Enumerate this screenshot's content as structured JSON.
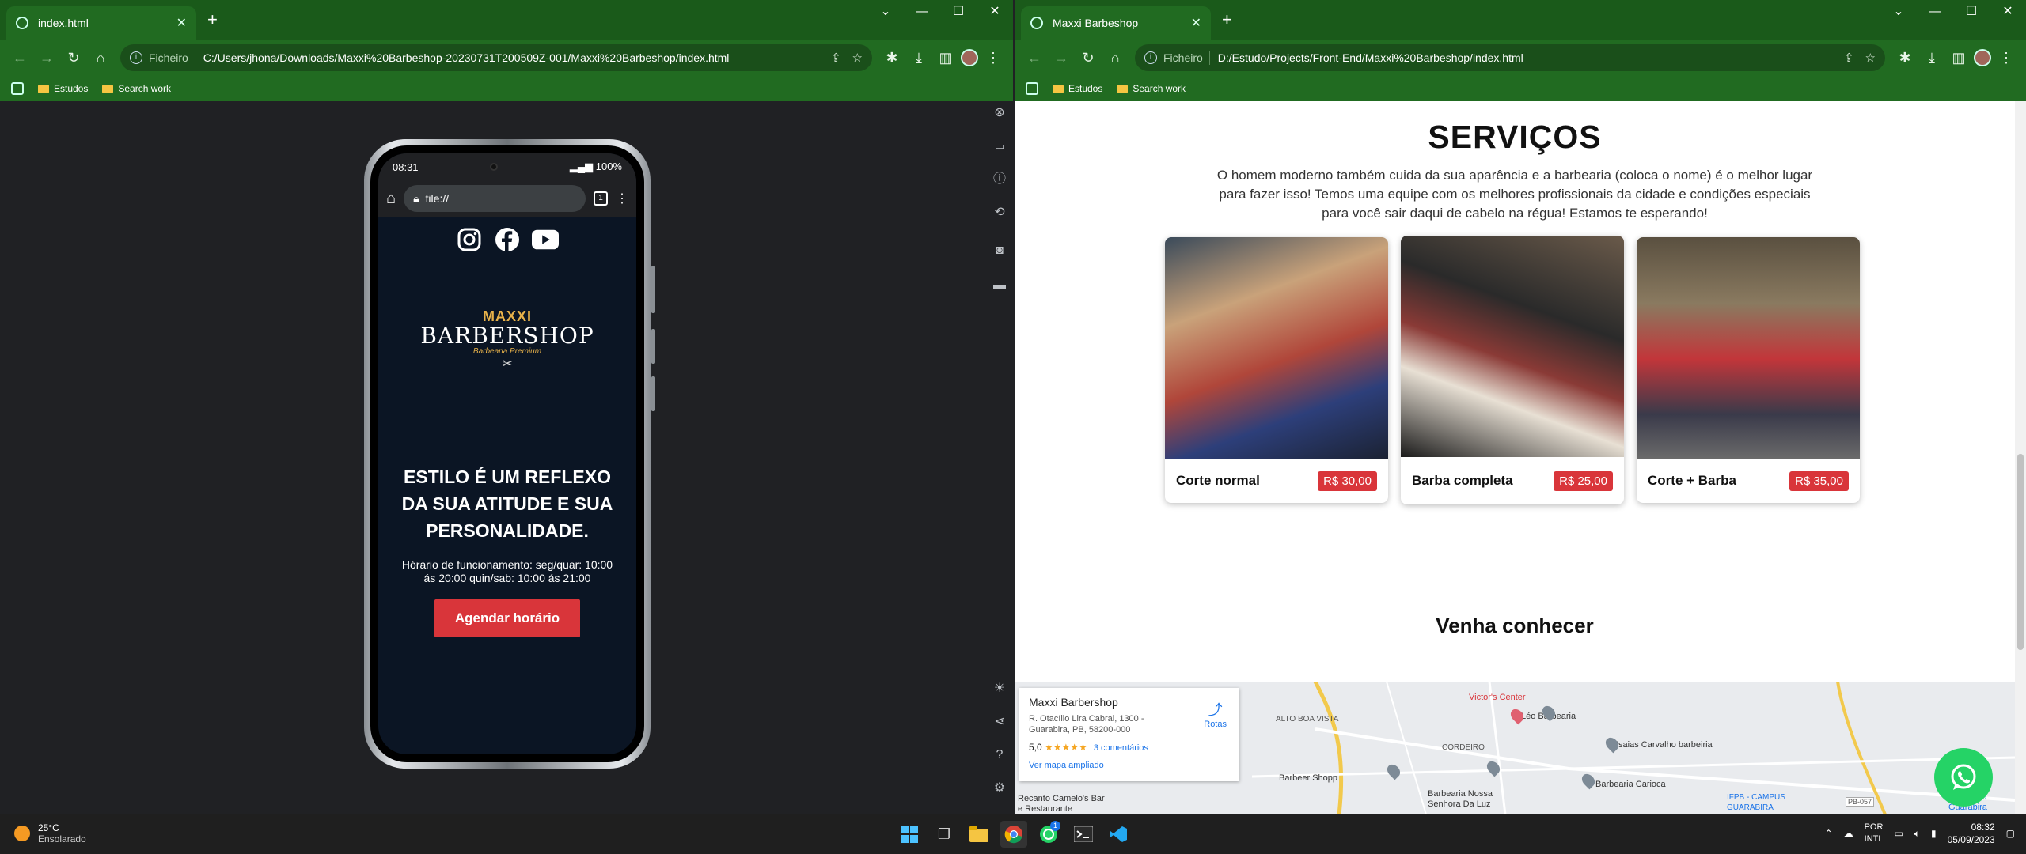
{
  "left_window": {
    "tab_title": "index.html",
    "url_scheme_label": "Ficheiro",
    "url": "C:/Users/jhona/Downloads/Maxxi%20Barbeshop-20230731T200509Z-001/Maxxi%20Barbeshop/index.html",
    "bookmarks": [
      "Estudos",
      "Search work"
    ]
  },
  "right_window": {
    "tab_title": "Maxxi Barbeshop",
    "url_scheme_label": "Ficheiro",
    "url": "D:/Estudo/Projects/Front-End/Maxxi%20Barbeshop/index.html",
    "bookmarks": [
      "Estudos",
      "Search work"
    ]
  },
  "phone": {
    "time": "08:31",
    "battery": "100%",
    "url": "file://",
    "tab_count": "1",
    "logo_top": "MAXXI",
    "logo_main": "BARBERSHOP",
    "logo_sub": "Barbearia Premium",
    "headline": "ESTILO É UM REFLEXO DA SUA ATITUDE E SUA PERSONALIDADE.",
    "hours": "Hórario de funcionamento: seg/quar: 10:00 ás 20:00 quin/sab: 10:00 ás 21:00",
    "cta": "Agendar horário"
  },
  "services": {
    "title": "SERVIÇOS",
    "description": "O homem moderno também cuida da sua aparência e a barbearia (coloca o nome) é o melhor lugar para fazer isso! Temos uma equipe com os melhores profissionais da cidade e condições especiais para você sair daqui de cabelo na régua! Estamos te esperando!",
    "items": [
      {
        "name": "Corte normal",
        "price": "R$ 30,00"
      },
      {
        "name": "Barba completa",
        "price": "R$ 25,00"
      },
      {
        "name": "Corte + Barba",
        "price": "R$ 35,00"
      }
    ]
  },
  "visit": {
    "title": "Venha conhecer",
    "map_card": {
      "name": "Maxxi Barbershop",
      "address": "R. Otacílio Lira Cabral, 1300 - Guarabira, PB, 58200-000",
      "rating": "5,0",
      "stars": "★★★★★",
      "reviews": "3 comentários",
      "larger_map": "Ver mapa ampliado",
      "directions": "Rotas"
    },
    "map_labels": [
      "Victor's Center",
      "Léo Barbearia",
      "ALTO BOA VISTA",
      "CORDEIRO",
      "Isaias Carvalho barbeiria",
      "Barbeer Shopp",
      "Barbearia Carioca",
      "Barbearia Nossa Senhora Da Luz",
      "Recanto Camelo's Bar e Restaurante",
      "IFPB - CAMPUS GUARABIRA",
      "Aeroporto Guarabira",
      "PB-057"
    ]
  },
  "taskbar": {
    "temp": "25°C",
    "weather": "Ensolarado",
    "lang1": "POR",
    "lang2": "INTL",
    "time": "08:32",
    "date": "05/09/2023",
    "whatsapp_badge": "1"
  },
  "colors": {
    "chrome_green": "#216b21",
    "accent_red": "#d9353a",
    "whatsapp": "#25d366"
  }
}
